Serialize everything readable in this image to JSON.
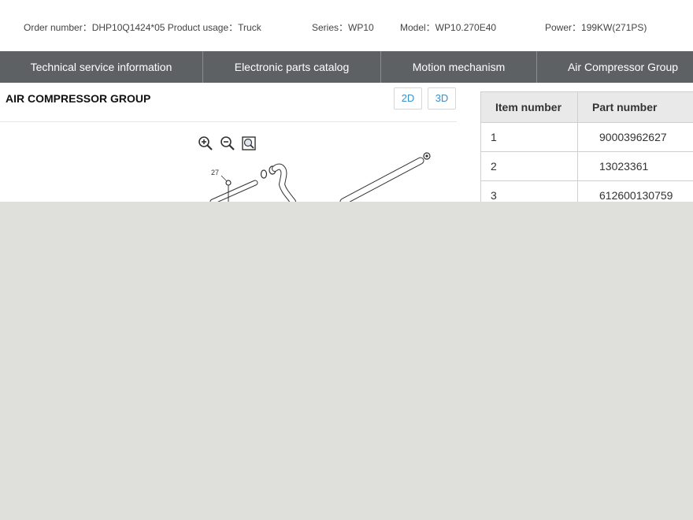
{
  "header": {
    "order_number": "Order number：DHP10Q1424*05 Product usage：Truck",
    "series": "Series：WP10",
    "model": "Model：WP10.270E40",
    "power": "Power：199KW(271PS)"
  },
  "nav": {
    "tabs": [
      {
        "label": "Technical service information"
      },
      {
        "label": "Electronic parts catalog"
      },
      {
        "label": "Motion mechanism"
      },
      {
        "label": "Air Compressor Group"
      }
    ]
  },
  "main": {
    "title": "AIR COMPRESSOR GROUP",
    "view_2d": "2D",
    "view_3d": "3D",
    "diagram_callout": "27"
  },
  "parts_table": {
    "headers": {
      "item": "Item number",
      "part": "Part number"
    },
    "rows": [
      {
        "item": "1",
        "part": "90003962627"
      },
      {
        "item": "2",
        "part": "13023361"
      },
      {
        "item": "3",
        "part": "612600130759"
      }
    ]
  },
  "colors": {
    "nav_bg": "#5e6164",
    "accent": "#3a8fc7",
    "backdrop": "#dfe0dc"
  }
}
